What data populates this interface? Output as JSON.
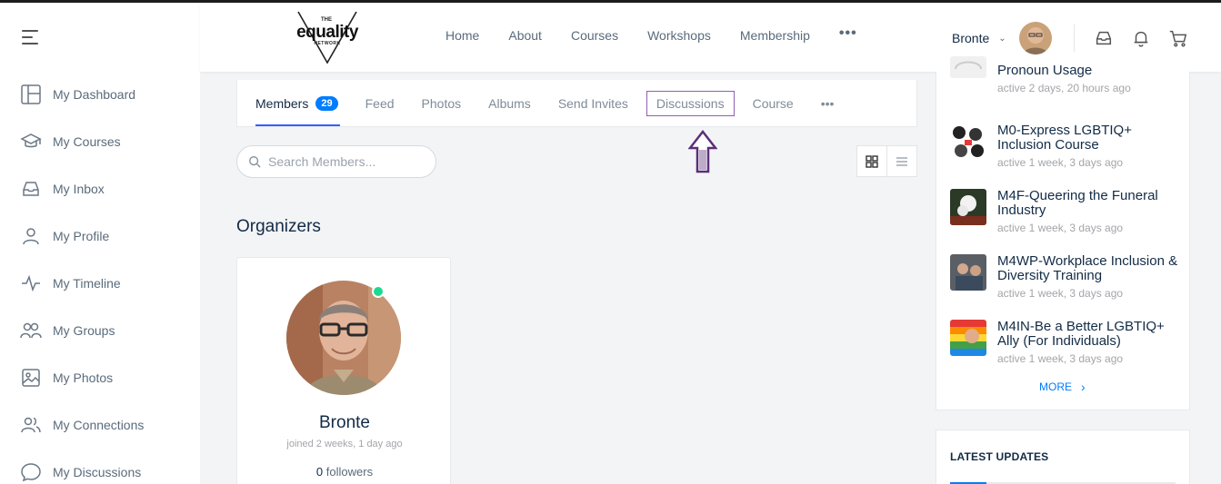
{
  "sidebar": {
    "items": [
      {
        "label": "My Dashboard",
        "icon": "dashboard-icon"
      },
      {
        "label": "My Courses",
        "icon": "graduation-cap-icon"
      },
      {
        "label": "My Inbox",
        "icon": "inbox-icon"
      },
      {
        "label": "My Profile",
        "icon": "user-icon"
      },
      {
        "label": "My Timeline",
        "icon": "activity-icon"
      },
      {
        "label": "My Groups",
        "icon": "groups-icon"
      },
      {
        "label": "My Photos",
        "icon": "image-icon"
      },
      {
        "label": "My Connections",
        "icon": "connections-icon"
      },
      {
        "label": "My Discussions",
        "icon": "chat-icon"
      }
    ]
  },
  "header": {
    "logo": {
      "top": "THE",
      "main": "equality",
      "bottom": "NETWORK"
    },
    "menu": [
      "Home",
      "About",
      "Courses",
      "Workshops",
      "Membership"
    ],
    "more": "•••",
    "user_name": "Bronte",
    "user_chevron": "⌄"
  },
  "tabs": {
    "members": "Members",
    "members_count": "29",
    "feed": "Feed",
    "photos": "Photos",
    "albums": "Albums",
    "send_invites": "Send Invites",
    "discussions": "Discussions",
    "course": "Course",
    "more": "•••"
  },
  "search": {
    "placeholder": "Search Members..."
  },
  "organizers": {
    "title": "Organizers",
    "member": {
      "name": "Bronte",
      "joined": "joined 2 weeks, 1 day ago",
      "followers_count": "0",
      "followers_label": " followers"
    }
  },
  "groups_widget": {
    "items": [
      {
        "title": "Pronoun Usage",
        "meta": "active 2 days, 20 hours ago"
      },
      {
        "title": "M0-Express LGBTIQ+ Inclusion Course",
        "meta": "active 1 week, 3 days ago"
      },
      {
        "title": "M4F-Queering the Funeral Industry",
        "meta": "active 1 week, 3 days ago"
      },
      {
        "title": "M4WP-Workplace Inclusion & Diversity Training",
        "meta": "active 1 week, 3 days ago"
      },
      {
        "title": "M4IN-Be a Better LGBTIQ+ Ally (For Individuals)",
        "meta": "active 1 week, 3 days ago"
      }
    ],
    "more": "MORE"
  },
  "latest_updates": {
    "title": "LATEST UPDATES"
  },
  "colors": {
    "accent": "#007cff",
    "online": "#1cd991",
    "highlight_box": "#8d5fb5"
  }
}
